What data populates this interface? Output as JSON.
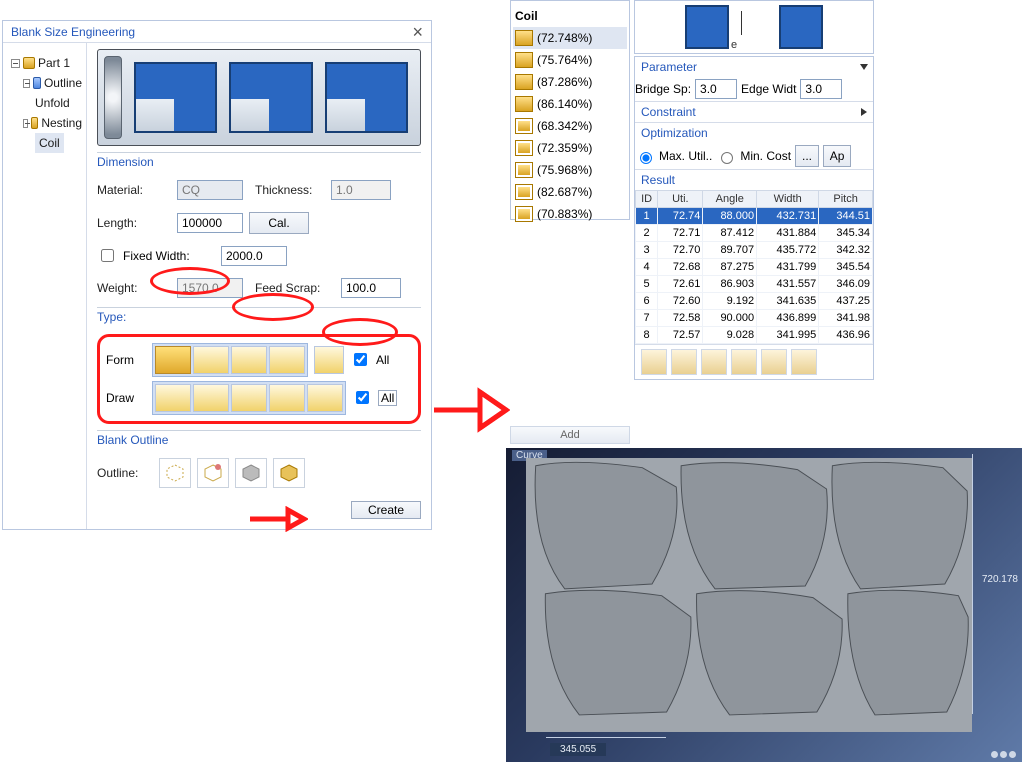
{
  "left": {
    "title": "Blank Size Engineering",
    "tree": {
      "root": "Part 1",
      "n1": "Outline",
      "n2": "Unfold",
      "n3": "Nesting",
      "n4": "Coil"
    },
    "dimension": {
      "title": "Dimension",
      "material_lbl": "Material:",
      "material_val": "CQ",
      "thickness_lbl": "Thickness:",
      "thickness_val": "1.0",
      "length_lbl": "Length:",
      "length_val": "100000",
      "cal_btn": "Cal.",
      "fixedwidth_lbl": "Fixed Width:",
      "fixedwidth_val": "2000.0",
      "weight_lbl": "Weight:",
      "weight_val": "1570.0",
      "feedscrap_lbl": "Feed Scrap:",
      "feedscrap_val": "100.0"
    },
    "type": {
      "title": "Type:",
      "form_lbl": "Form",
      "draw_lbl": "Draw",
      "all_lbl": "All"
    },
    "outline": {
      "title": "Blank Outline",
      "lbl": "Outline:"
    },
    "create_btn": "Create"
  },
  "coil_tree": {
    "title": "Coil",
    "items": [
      {
        "pct": "(72.748%)",
        "sel": true,
        "style": "f"
      },
      {
        "pct": "(75.764%)",
        "sel": false,
        "style": "f"
      },
      {
        "pct": "(87.286%)",
        "sel": false,
        "style": "f2"
      },
      {
        "pct": "(86.140%)",
        "sel": false,
        "style": "f2"
      },
      {
        "pct": "(68.342%)",
        "sel": false,
        "style": "o"
      },
      {
        "pct": "(72.359%)",
        "sel": false,
        "style": "o"
      },
      {
        "pct": "(75.968%)",
        "sel": false,
        "style": "o"
      },
      {
        "pct": "(82.687%)",
        "sel": false,
        "style": "o"
      },
      {
        "pct": "(70.883%)",
        "sel": false,
        "style": "o"
      }
    ]
  },
  "top_right_e": "e",
  "right": {
    "parameter": {
      "title": "Parameter",
      "bridge_lbl": "Bridge Sp:",
      "bridge_val": "3.0",
      "edge_lbl": "Edge Widt",
      "edge_val": "3.0"
    },
    "constraint": {
      "title": "Constraint"
    },
    "optimization": {
      "title": "Optimization",
      "max_lbl": "Max. Util..",
      "min_lbl": "Min. Cost",
      "more": "...",
      "apply": "Ap"
    },
    "result": {
      "title": "Result",
      "cols": {
        "c1": "ID",
        "c2": "Uti.",
        "c3": "Angle",
        "c4": "Width",
        "c5": "Pitch"
      },
      "rows": [
        {
          "id": "1",
          "u": "72.74",
          "a": "88.000",
          "w": "432.731",
          "p": "344.51"
        },
        {
          "id": "2",
          "u": "72.71",
          "a": "87.412",
          "w": "431.884",
          "p": "345.34"
        },
        {
          "id": "3",
          "u": "72.70",
          "a": "89.707",
          "w": "435.772",
          "p": "342.32"
        },
        {
          "id": "4",
          "u": "72.68",
          "a": "87.275",
          "w": "431.799",
          "p": "345.54"
        },
        {
          "id": "5",
          "u": "72.61",
          "a": "86.903",
          "w": "431.557",
          "p": "346.09"
        },
        {
          "id": "6",
          "u": "72.60",
          "a": "9.192",
          "w": "341.635",
          "p": "437.25"
        },
        {
          "id": "7",
          "u": "72.58",
          "a": "90.000",
          "w": "436.899",
          "p": "341.98"
        },
        {
          "id": "8",
          "u": "72.57",
          "a": "9.028",
          "w": "341.995",
          "p": "436.96"
        }
      ]
    },
    "add_btn": "Add"
  },
  "viewport": {
    "label": "Curve",
    "dim_right": "720.178",
    "dim_bottom": "345.055"
  }
}
